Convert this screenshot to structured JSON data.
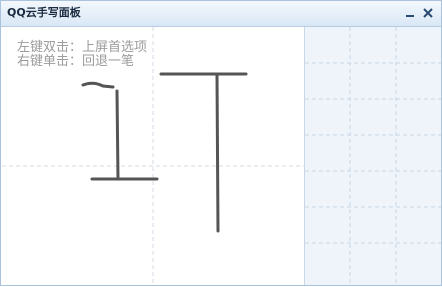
{
  "window": {
    "title": "QQ云手写面板",
    "minimize_icon": "minimize-icon",
    "close_icon": "close-icon"
  },
  "writing_pad": {
    "hint_line1": "左键双击：上屏首选项",
    "hint_line2": "右键单击：回退一笔"
  },
  "candidate_panel": {
    "columns": 3,
    "rows": 7
  },
  "colors": {
    "titlebar": "#dce9f6",
    "border": "#a9c3dd",
    "ink": "#555555",
    "guide": "#d6dde5",
    "candidate_bg": "#eef4fa"
  }
}
